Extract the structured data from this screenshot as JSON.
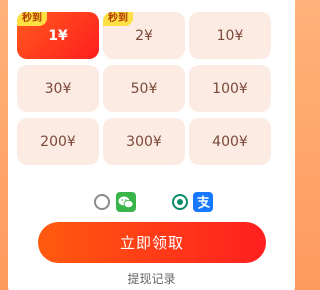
{
  "amounts": {
    "items": [
      {
        "label": "1¥",
        "badge": "秒到",
        "selected": true
      },
      {
        "label": "2¥",
        "badge": "秒到",
        "selected": false
      },
      {
        "label": "10¥",
        "badge": "",
        "selected": false
      },
      {
        "label": "30¥",
        "badge": "",
        "selected": false
      },
      {
        "label": "50¥",
        "badge": "",
        "selected": false
      },
      {
        "label": "100¥",
        "badge": "",
        "selected": false
      },
      {
        "label": "200¥",
        "badge": "",
        "selected": false
      },
      {
        "label": "300¥",
        "badge": "",
        "selected": false
      },
      {
        "label": "400¥",
        "badge": "",
        "selected": false
      }
    ]
  },
  "payment": {
    "options": [
      {
        "icon": "wechat-pay-icon",
        "selected": false
      },
      {
        "icon": "alipay-icon",
        "selected": true
      }
    ]
  },
  "actions": {
    "claim_label": "立即领取",
    "record_label": "提现记录"
  },
  "colors": {
    "accent": "#ff3a1a",
    "tile_bg": "#fcebe3",
    "badge": "#ffe044",
    "radio_selected": "#0b8b6b"
  }
}
